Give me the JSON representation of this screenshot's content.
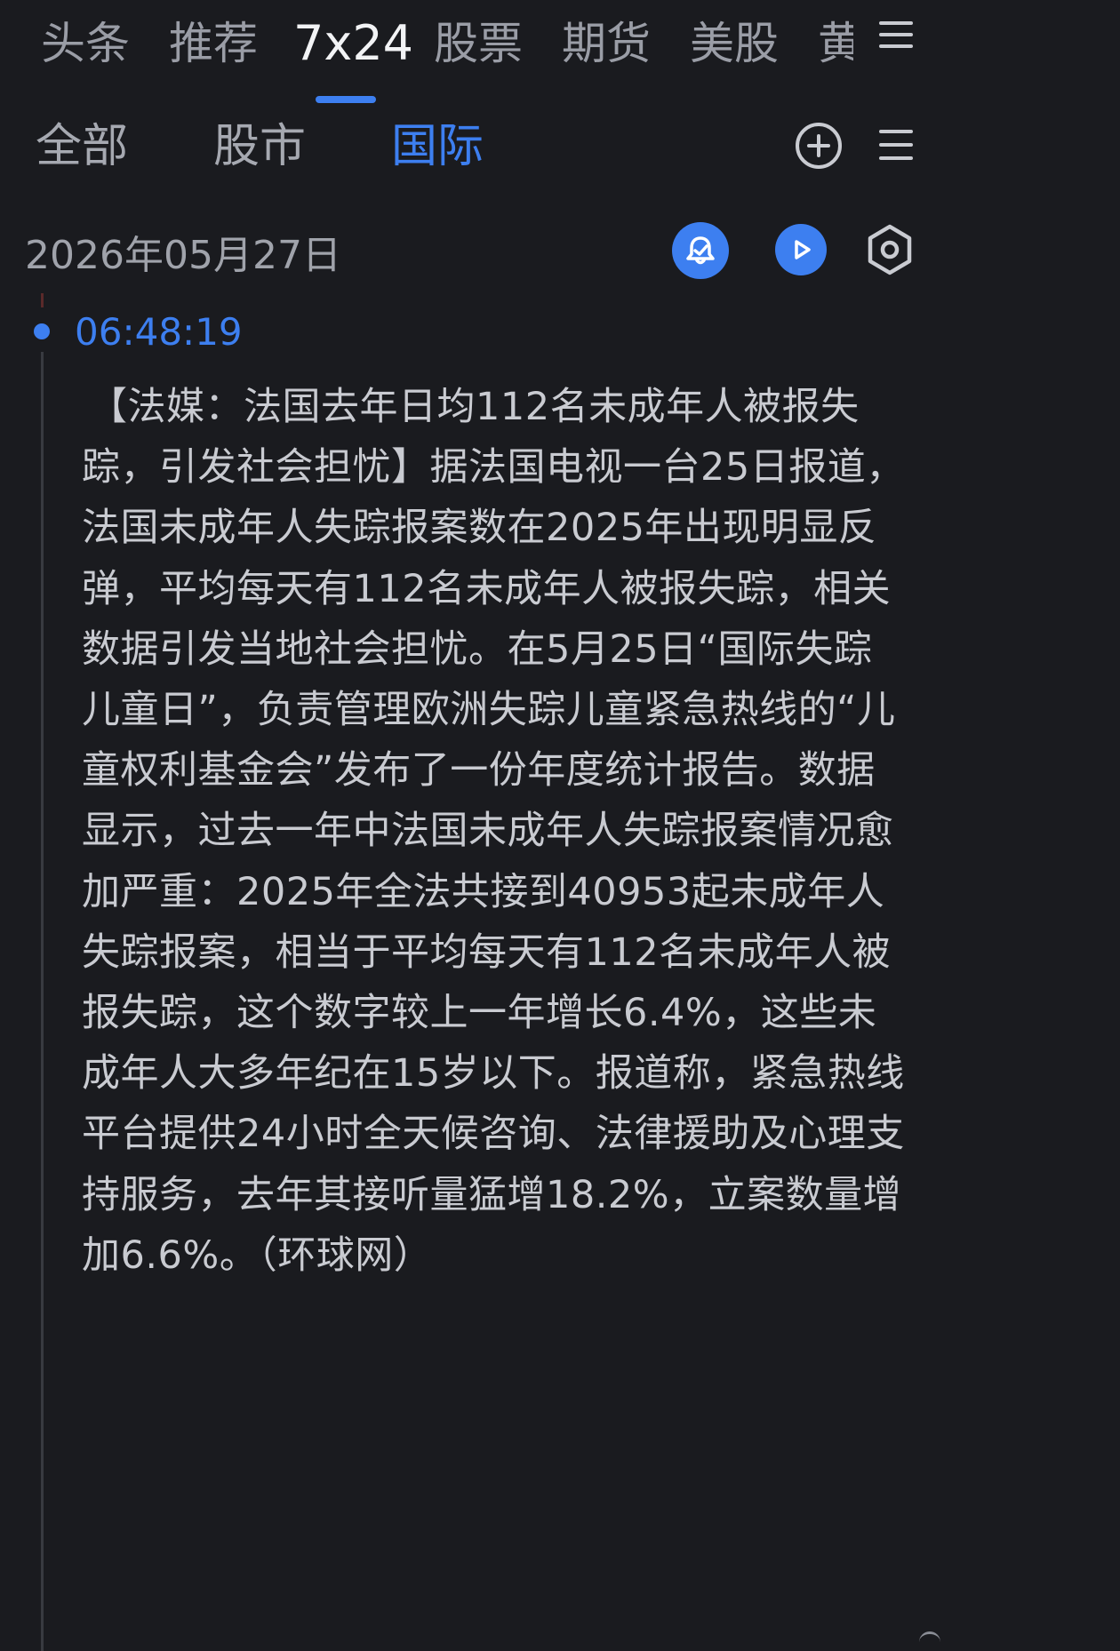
{
  "top_tabs": [
    {
      "label": "头条"
    },
    {
      "label": "推荐"
    },
    {
      "label": "7x24"
    },
    {
      "label": "股票"
    },
    {
      "label": "期货"
    },
    {
      "label": "美股"
    }
  ],
  "top_tabs_clipped": "黄",
  "sub_tabs": [
    {
      "label": "全部"
    },
    {
      "label": "股市"
    },
    {
      "label": "国际"
    }
  ],
  "date_label": "2026年05月27日",
  "news": {
    "time": "06:48:19",
    "content": "【法媒：法国去年日均112名未成年人被报失踪，引发社会担忧】据法国电视一台25日报道，法国未成年人失踪报案数在2025年出现明显反弹，平均每天有112名未成年人被报失踪，相关数据引发当地社会担忧。在5月25日“国际失踪儿童日”，负责管理欧洲失踪儿童紧急热线的“儿童权利基金会”发布了一份年度统计报告。数据显示，过去一年中法国未成年人失踪报案情况愈加严重：2025年全法共接到40953起未成年人失踪报案，相当于平均每天有112名未成年人被报失踪，这个数字较上一年增长6.4%，这些未成年人大多年纪在15岁以下。报道称，紧急热线平台提供24小时全天候咨询、法律援助及心理支持服务，去年其接听量猛增18.2%，立案数量增加6.6%。（环球网）"
  },
  "colors": {
    "background": "#1a1b1f",
    "accent": "#3d7ff0",
    "text": "#c9cbd1"
  },
  "icons": [
    "menu-icon",
    "add-circle-icon",
    "list-icon",
    "bell-icon",
    "play-icon",
    "settings-icon"
  ]
}
